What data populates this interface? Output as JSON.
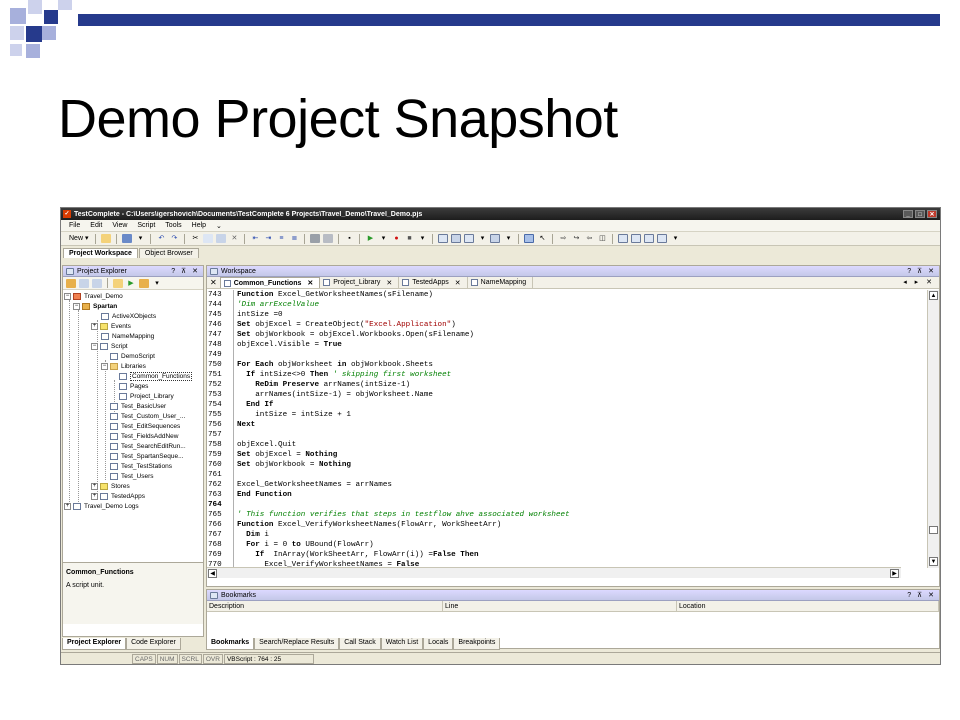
{
  "slide": {
    "title": "Demo Project Snapshot",
    "accent_color": "#263a8c",
    "accent_light": "#a7b0dc"
  },
  "window": {
    "title": "TestComplete - C:\\Users\\igershovich\\Documents\\TestComplete 6 Projects\\Travel_Demo\\Travel_Demo.pjs",
    "minimize": "_",
    "maximize": "□",
    "close": "✕"
  },
  "menu": [
    "File",
    "Edit",
    "View",
    "Script",
    "Tools",
    "Help"
  ],
  "menu_more": "⌄",
  "toolbar": {
    "new_label": "New ▾"
  },
  "workspace_tabs": [
    "Project Workspace",
    "Object Browser"
  ],
  "project_explorer": {
    "title": "Project Explorer",
    "header_buttons": "? ⊼ ✕",
    "tree": [
      {
        "label": "Travel_Demo"
      },
      {
        "label": "Spartan"
      },
      {
        "label": "ActiveXObjects"
      },
      {
        "label": "Events"
      },
      {
        "label": "NameMapping"
      },
      {
        "label": "Script"
      },
      {
        "label": "DemoScript"
      },
      {
        "label": "Libraries"
      },
      {
        "label": "Common_Functions"
      },
      {
        "label": "Pages"
      },
      {
        "label": "Project_Library"
      },
      {
        "label": "Test_BasicUser"
      },
      {
        "label": "Test_Custom_User_..."
      },
      {
        "label": "Test_EditSequences"
      },
      {
        "label": "Test_FieldsAddNew"
      },
      {
        "label": "Test_SearchEditRun..."
      },
      {
        "label": "Test_SpartanSeque..."
      },
      {
        "label": "Test_TestStations"
      },
      {
        "label": "Test_Users"
      },
      {
        "label": "Stores"
      },
      {
        "label": "TestedApps"
      },
      {
        "label": "Travel_Demo Logs"
      }
    ],
    "description_title": "Common_Functions",
    "description_text": "A script unit."
  },
  "left_bottom_tabs": [
    "Project Explorer",
    "Code Explorer"
  ],
  "workspace": {
    "title": "Workspace",
    "header_buttons": "? ⊼ ✕",
    "close_tab": "✕",
    "nav": "◂ ▸ ✕",
    "doc_tabs": [
      "Common_Functions",
      "Project_Library",
      "TestedApps",
      "NameMapping"
    ]
  },
  "code": [
    {
      "ln": "743",
      "parts": [
        {
          "t": "Function",
          "c": "kw"
        },
        {
          "t": " Excel_GetWorksheetNames(sFilename)",
          "c": ""
        }
      ]
    },
    {
      "ln": "744",
      "parts": [
        {
          "t": "'Dim arrExcelValue",
          "c": "cm"
        }
      ]
    },
    {
      "ln": "745",
      "parts": [
        {
          "t": "intSize =0",
          "c": ""
        }
      ]
    },
    {
      "ln": "746",
      "parts": [
        {
          "t": "Set",
          "c": "kw"
        },
        {
          "t": " objExcel = CreateObject(",
          "c": ""
        },
        {
          "t": "\"Excel.Application\"",
          "c": "st"
        },
        {
          "t": ")",
          "c": ""
        }
      ]
    },
    {
      "ln": "747",
      "parts": [
        {
          "t": "Set",
          "c": "kw"
        },
        {
          "t": " objWorkbook = objExcel.Workbooks.Open(sFilename)",
          "c": ""
        }
      ]
    },
    {
      "ln": "748",
      "parts": [
        {
          "t": "objExcel.Visible = ",
          "c": ""
        },
        {
          "t": "True",
          "c": "kw"
        }
      ]
    },
    {
      "ln": "749",
      "parts": []
    },
    {
      "ln": "750",
      "parts": [
        {
          "t": "For Each",
          "c": "kw"
        },
        {
          "t": " objWorksheet ",
          "c": ""
        },
        {
          "t": "in",
          "c": "kw"
        },
        {
          "t": " objWorkbook.Sheets",
          "c": ""
        }
      ]
    },
    {
      "ln": "751",
      "parts": [
        {
          "t": "  If",
          "c": "kw"
        },
        {
          "t": " intSize<>0 ",
          "c": ""
        },
        {
          "t": "Then",
          "c": "kw"
        },
        {
          "t": " ' skipping first worksheet",
          "c": "cm"
        }
      ]
    },
    {
      "ln": "752",
      "parts": [
        {
          "t": "    ReDim Preserve",
          "c": "kw"
        },
        {
          "t": " arrNames(intSize-1)",
          "c": ""
        }
      ]
    },
    {
      "ln": "753",
      "parts": [
        {
          "t": "    arrNames(intSize-1) = objWorksheet.Name",
          "c": ""
        }
      ]
    },
    {
      "ln": "754",
      "parts": [
        {
          "t": "  End If",
          "c": "kw"
        }
      ]
    },
    {
      "ln": "755",
      "parts": [
        {
          "t": "    intSize = intSize + 1",
          "c": ""
        }
      ]
    },
    {
      "ln": "756",
      "parts": [
        {
          "t": "Next",
          "c": "kw"
        }
      ]
    },
    {
      "ln": "757",
      "parts": []
    },
    {
      "ln": "758",
      "parts": [
        {
          "t": "objExcel.Quit",
          "c": ""
        }
      ]
    },
    {
      "ln": "759",
      "parts": [
        {
          "t": "Set",
          "c": "kw"
        },
        {
          "t": " objExcel = ",
          "c": ""
        },
        {
          "t": "Nothing",
          "c": "kw"
        }
      ]
    },
    {
      "ln": "760",
      "parts": [
        {
          "t": "Set",
          "c": "kw"
        },
        {
          "t": " objWorkbook = ",
          "c": ""
        },
        {
          "t": "Nothing",
          "c": "kw"
        }
      ]
    },
    {
      "ln": "761",
      "parts": []
    },
    {
      "ln": "762",
      "parts": [
        {
          "t": "Excel_GetWorksheetNames = arrNames",
          "c": ""
        }
      ]
    },
    {
      "ln": "763",
      "parts": [
        {
          "t": "End Function",
          "c": "kw"
        }
      ]
    },
    {
      "ln": "764",
      "parts": [],
      "bold": true
    },
    {
      "ln": "765",
      "parts": [
        {
          "t": "' This function verifies that steps in testflow ahve associated worksheet",
          "c": "cm"
        }
      ]
    },
    {
      "ln": "766",
      "parts": [
        {
          "t": "Function",
          "c": "kw"
        },
        {
          "t": " Excel_VerifyWorksheetNames(FlowArr, WorkSheetArr)",
          "c": ""
        }
      ]
    },
    {
      "ln": "767",
      "parts": [
        {
          "t": "  Dim",
          "c": "kw"
        },
        {
          "t": " i",
          "c": ""
        }
      ]
    },
    {
      "ln": "768",
      "parts": [
        {
          "t": "  For",
          "c": "kw"
        },
        {
          "t": " i = 0 ",
          "c": ""
        },
        {
          "t": "to",
          "c": "kw"
        },
        {
          "t": " UBound(FlowArr)",
          "c": ""
        }
      ]
    },
    {
      "ln": "769",
      "parts": [
        {
          "t": "    If",
          "c": "kw"
        },
        {
          "t": "  InArray(WorkSheetArr, FlowArr(i)) =",
          "c": ""
        },
        {
          "t": "False Then",
          "c": "kw"
        }
      ]
    },
    {
      "ln": "770",
      "parts": [
        {
          "t": "      Excel_VerifyWorksheetNames = ",
          "c": ""
        },
        {
          "t": "False",
          "c": "kw"
        }
      ]
    }
  ],
  "bookmarks": {
    "title": "Bookmarks",
    "header_buttons": "? ⊼ ✕",
    "columns": [
      "Description",
      "Line",
      "Location"
    ]
  },
  "bottom_tabs": [
    "Bookmarks",
    "Search/Replace Results",
    "Call Stack",
    "Watch List",
    "Locals",
    "Breakpoints"
  ],
  "status": {
    "caps": "CAPS",
    "num": "NUM",
    "scrl": "SCRL",
    "ovr": "OVR",
    "position": "VBScript :   764 :   25"
  }
}
